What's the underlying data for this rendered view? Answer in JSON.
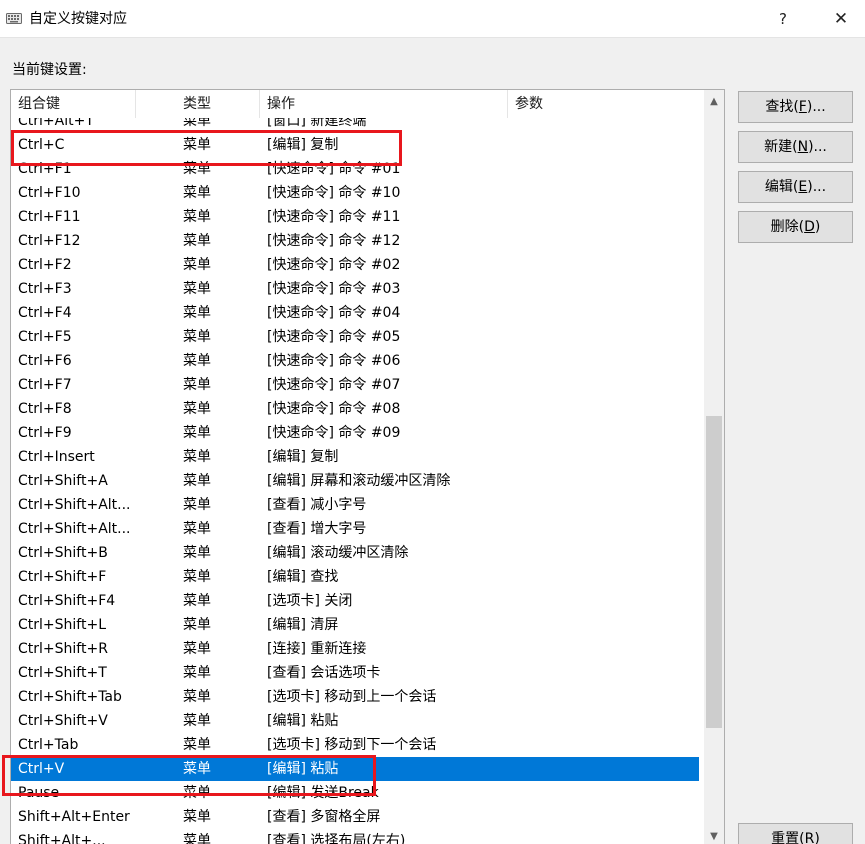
{
  "window": {
    "title": "自定义按键对应",
    "icon": "keyboard-icon",
    "help_label": "?",
    "close_label": "✕"
  },
  "current_label": "当前键设置:",
  "columns": [
    "组合键",
    "类型",
    "操作",
    "参数"
  ],
  "rows": [
    {
      "key": "Ctrl+Alt+T",
      "type": "菜单",
      "op": "[窗口] 新建终端",
      "param": ""
    },
    {
      "key": "Ctrl+C",
      "type": "菜单",
      "op": "[编辑] 复制",
      "param": ""
    },
    {
      "key": "Ctrl+F1",
      "type": "菜单",
      "op": "[快速命令] 命令 #01",
      "param": ""
    },
    {
      "key": "Ctrl+F10",
      "type": "菜单",
      "op": "[快速命令] 命令 #10",
      "param": ""
    },
    {
      "key": "Ctrl+F11",
      "type": "菜单",
      "op": "[快速命令] 命令 #11",
      "param": ""
    },
    {
      "key": "Ctrl+F12",
      "type": "菜单",
      "op": "[快速命令] 命令 #12",
      "param": ""
    },
    {
      "key": "Ctrl+F2",
      "type": "菜单",
      "op": "[快速命令] 命令 #02",
      "param": ""
    },
    {
      "key": "Ctrl+F3",
      "type": "菜单",
      "op": "[快速命令] 命令 #03",
      "param": ""
    },
    {
      "key": "Ctrl+F4",
      "type": "菜单",
      "op": "[快速命令] 命令 #04",
      "param": ""
    },
    {
      "key": "Ctrl+F5",
      "type": "菜单",
      "op": "[快速命令] 命令 #05",
      "param": ""
    },
    {
      "key": "Ctrl+F6",
      "type": "菜单",
      "op": "[快速命令] 命令 #06",
      "param": ""
    },
    {
      "key": "Ctrl+F7",
      "type": "菜单",
      "op": "[快速命令] 命令 #07",
      "param": ""
    },
    {
      "key": "Ctrl+F8",
      "type": "菜单",
      "op": "[快速命令] 命令 #08",
      "param": ""
    },
    {
      "key": "Ctrl+F9",
      "type": "菜单",
      "op": "[快速命令] 命令 #09",
      "param": ""
    },
    {
      "key": "Ctrl+Insert",
      "type": "菜单",
      "op": "[编辑] 复制",
      "param": ""
    },
    {
      "key": "Ctrl+Shift+A",
      "type": "菜单",
      "op": "[编辑] 屏幕和滚动缓冲区清除",
      "param": ""
    },
    {
      "key": "Ctrl+Shift+Alt...",
      "type": "菜单",
      "op": "[查看] 减小字号",
      "param": ""
    },
    {
      "key": "Ctrl+Shift+Alt...",
      "type": "菜单",
      "op": "[查看] 增大字号",
      "param": ""
    },
    {
      "key": "Ctrl+Shift+B",
      "type": "菜单",
      "op": "[编辑] 滚动缓冲区清除",
      "param": ""
    },
    {
      "key": "Ctrl+Shift+F",
      "type": "菜单",
      "op": "[编辑] 查找",
      "param": ""
    },
    {
      "key": "Ctrl+Shift+F4",
      "type": "菜单",
      "op": "[选项卡] 关闭",
      "param": ""
    },
    {
      "key": "Ctrl+Shift+L",
      "type": "菜单",
      "op": "[编辑] 清屏",
      "param": ""
    },
    {
      "key": "Ctrl+Shift+R",
      "type": "菜单",
      "op": "[连接] 重新连接",
      "param": ""
    },
    {
      "key": "Ctrl+Shift+T",
      "type": "菜单",
      "op": "[查看] 会话选项卡",
      "param": ""
    },
    {
      "key": "Ctrl+Shift+Tab",
      "type": "菜单",
      "op": "[选项卡] 移动到上一个会话",
      "param": ""
    },
    {
      "key": "Ctrl+Shift+V",
      "type": "菜单",
      "op": "[编辑] 粘贴",
      "param": ""
    },
    {
      "key": "Ctrl+Tab",
      "type": "菜单",
      "op": "[选项卡] 移动到下一个会话",
      "param": ""
    },
    {
      "key": "Ctrl+V",
      "type": "菜单",
      "op": "[编辑] 粘贴",
      "param": "",
      "selected": true
    },
    {
      "key": "Pause",
      "type": "菜单",
      "op": "[编辑] 发送Break",
      "param": ""
    },
    {
      "key": "Shift+Alt+Enter",
      "type": "菜单",
      "op": "[查看] 多窗格全屏",
      "param": ""
    },
    {
      "key": "Shift+Alt+...",
      "type": "菜单",
      "op": "[查看] 选择布局(左右)",
      "param": ""
    }
  ],
  "buttons": {
    "find": {
      "text": "查找(",
      "key": "F",
      "suffix": ")..."
    },
    "new": {
      "text": "新建(",
      "key": "N",
      "suffix": ")..."
    },
    "edit": {
      "text": "编辑(",
      "key": "E",
      "suffix": ")..."
    },
    "delete": {
      "text": "删除(",
      "key": "D",
      "suffix": ")"
    },
    "reset": {
      "text": "重置(",
      "key": "R",
      "suffix": ")"
    }
  },
  "colors": {
    "selection": "#0078d7",
    "annotation": "#e8171d"
  }
}
